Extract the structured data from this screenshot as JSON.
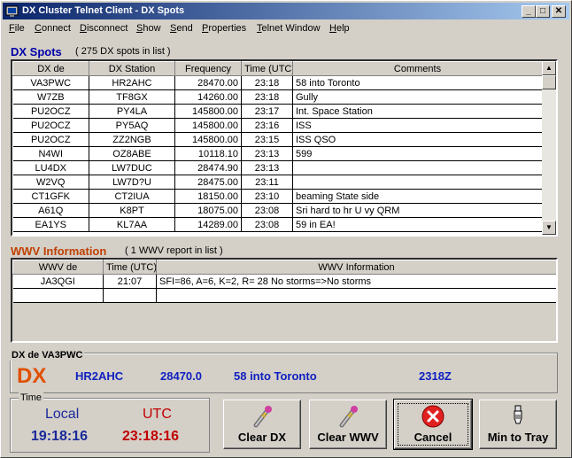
{
  "window": {
    "title": "DX Cluster Telnet Client - DX Spots",
    "controls": {
      "minimize": "_",
      "maximize": "□",
      "close": "✕"
    }
  },
  "menu": [
    "File",
    "Connect",
    "Disconnect",
    "Show",
    "Send",
    "Properties",
    "Telnet Window",
    "Help"
  ],
  "dx_spots": {
    "title": "DX Spots",
    "count_text": "( 275 DX spots in list )",
    "columns": [
      "DX de",
      "DX Station",
      "Frequency",
      "Time (UTC)",
      "Comments"
    ],
    "rows": [
      [
        "VA3PWC",
        "HR2AHC",
        "28470.00",
        "23:18",
        "58 into Toronto"
      ],
      [
        "W7ZB",
        "TF8GX",
        "14260.00",
        "23:18",
        "Gully"
      ],
      [
        "PU2OCZ",
        "PY4LA",
        "145800.00",
        "23:17",
        "Int. Space Station"
      ],
      [
        "PU2OCZ",
        "PY5AQ",
        "145800.00",
        "23:16",
        "ISS"
      ],
      [
        "PU2OCZ",
        "ZZ2NGB",
        "145800.00",
        "23:15",
        "ISS QSO"
      ],
      [
        "N4WI",
        "OZ8ABE",
        "10118.10",
        "23:13",
        "599"
      ],
      [
        "LU4DX",
        "LW7DUC",
        "28474.90",
        "23:13",
        ""
      ],
      [
        "W2VQ",
        "LW7D?U",
        "28475.00",
        "23:11",
        ""
      ],
      [
        "CT1GFK",
        "CT2IUA",
        "18150.00",
        "23:10",
        "beaming State side"
      ],
      [
        "A61Q",
        "K8PT",
        "18075.00",
        "23:08",
        "Sri hard to hr U vy QRM"
      ],
      [
        "EA1YS",
        "KL7AA",
        "14289.00",
        "23:08",
        "59 in EA!"
      ]
    ]
  },
  "wwv": {
    "title": "WWV Information",
    "count_text": "( 1 WWV report in list )",
    "columns": [
      "WWV de",
      "Time (UTC)",
      "WWV Information"
    ],
    "rows": [
      [
        "JA3QGI",
        "21:07",
        "SFI=86, A=6, K=2, R= 28 No storms=>No storms"
      ]
    ]
  },
  "dx_de": {
    "label": "DX de VA3PWC",
    "prefix": "DX",
    "station": "HR2AHC",
    "frequency": "28470.0",
    "comment": "58 into Toronto",
    "time": "2318Z"
  },
  "time_box": {
    "label": "Time",
    "local_label": "Local",
    "utc_label": "UTC",
    "local_time": "19:18:16",
    "utc_time": "23:18:16"
  },
  "buttons": {
    "clear_dx": "Clear DX",
    "clear_wwv": "Clear WWV",
    "cancel": "Cancel",
    "min_to_tray": "Min to Tray"
  },
  "colors": {
    "title_start": "#0a246a",
    "title_end": "#a6caf0",
    "section_blue": "#0000a8",
    "wwv_orange": "#c04000",
    "dx_orange": "#e05000",
    "dx_blue": "#1020c0",
    "time_blue": "#1a2a9a",
    "time_red": "#c00000"
  }
}
